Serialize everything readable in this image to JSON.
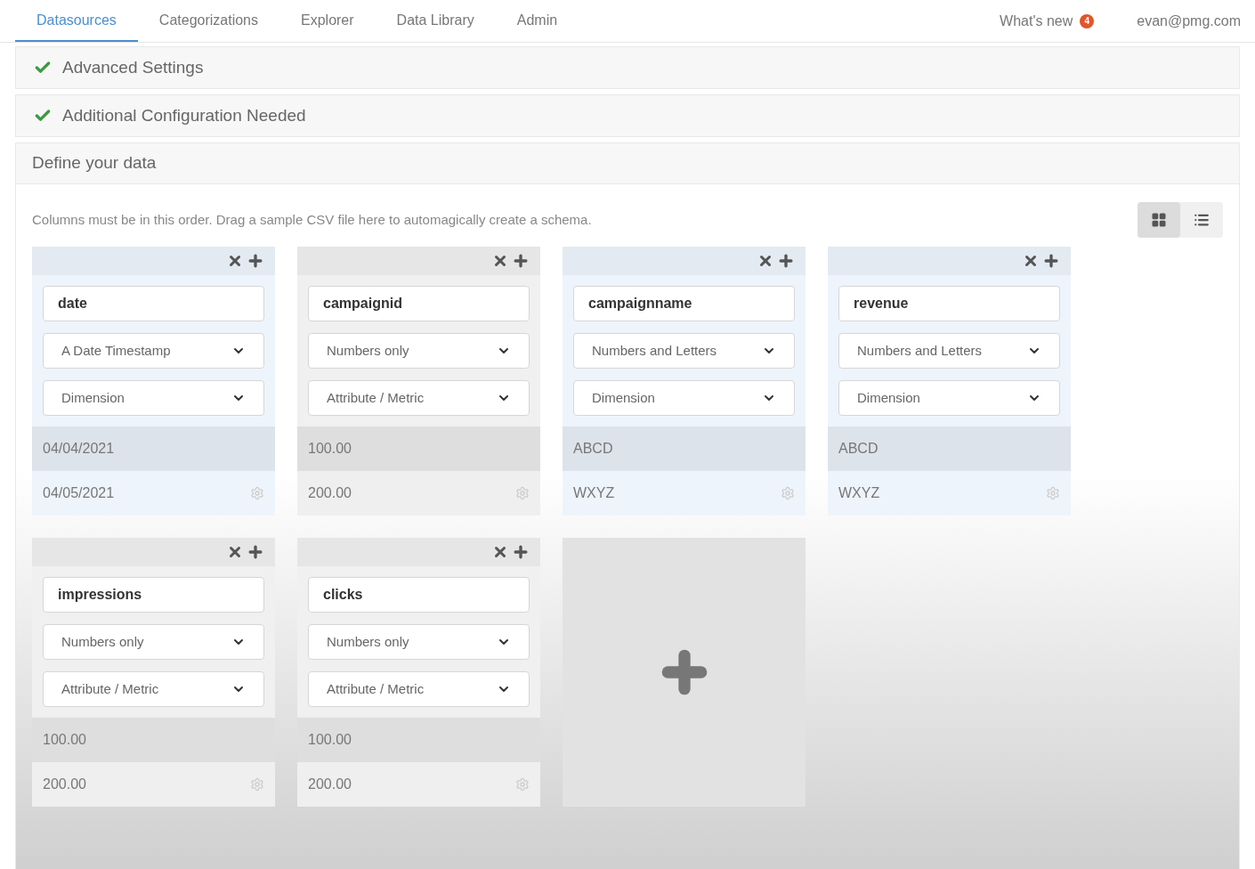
{
  "nav": {
    "tabs": [
      {
        "label": "Datasources",
        "selected": true
      },
      {
        "label": "Categorizations",
        "selected": false
      },
      {
        "label": "Explorer",
        "selected": false
      },
      {
        "label": "Data Library",
        "selected": false
      },
      {
        "label": "Admin",
        "selected": false
      }
    ],
    "whats_new": "What's new",
    "whats_new_count": "4",
    "user": "evan@pmg.com"
  },
  "sections": [
    {
      "title": "Advanced Settings",
      "done": true
    },
    {
      "title": "Additional Configuration Needed",
      "done": true
    }
  ],
  "define": {
    "title": "Define your data",
    "hint": "Columns must be in this order. Drag a sample CSV file here to automagically create a schema.",
    "view_toggle": [
      {
        "kind": "grid",
        "selected": true
      },
      {
        "kind": "list",
        "selected": false
      }
    ],
    "columns": [
      {
        "name": "date",
        "type": "A Date Timestamp",
        "role": "Dimension",
        "kind": "dimension",
        "samples": [
          "04/04/2021",
          "04/05/2021"
        ]
      },
      {
        "name": "campaignid",
        "type": "Numbers only",
        "role": "Attribute / Metric",
        "kind": "metric",
        "samples": [
          "100.00",
          "200.00"
        ]
      },
      {
        "name": "campaignname",
        "type": "Numbers and Letters",
        "role": "Dimension",
        "kind": "dimension",
        "samples": [
          "ABCD",
          "WXYZ"
        ]
      },
      {
        "name": "revenue",
        "type": "Numbers and Letters",
        "role": "Dimension",
        "kind": "dimension",
        "samples": [
          "ABCD",
          "WXYZ"
        ]
      },
      {
        "name": "impressions",
        "type": "Numbers only",
        "role": "Attribute / Metric",
        "kind": "metric",
        "samples": [
          "100.00",
          "200.00"
        ]
      },
      {
        "name": "clicks",
        "type": "Numbers only",
        "role": "Attribute / Metric",
        "kind": "metric",
        "samples": [
          "100.00",
          "200.00"
        ]
      }
    ]
  }
}
